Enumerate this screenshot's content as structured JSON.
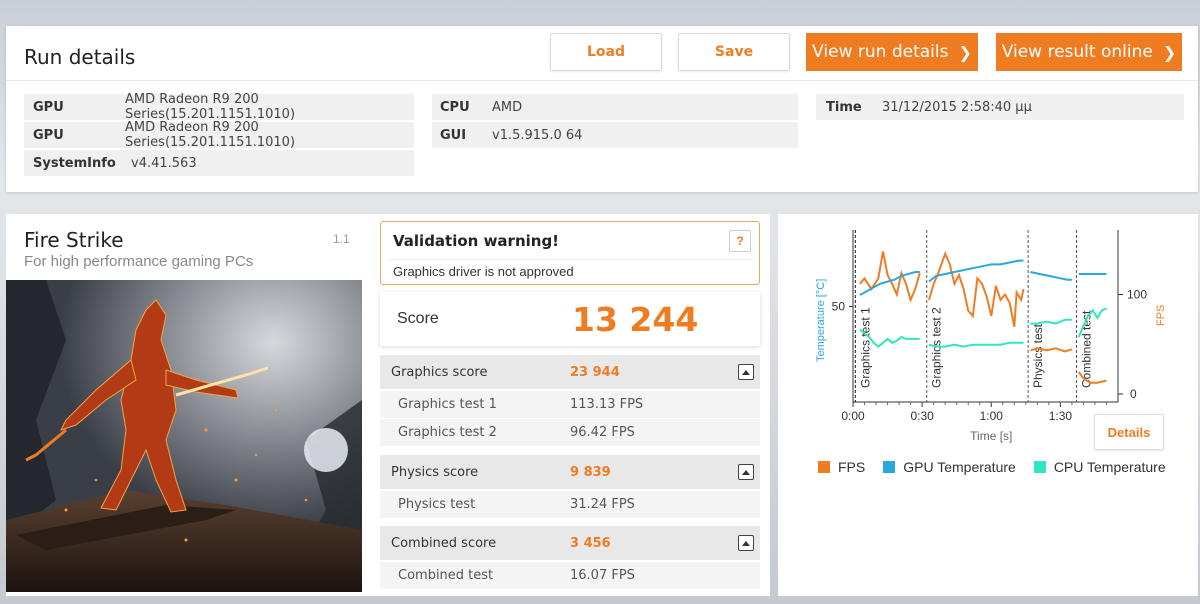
{
  "run_details": {
    "title": "Run details",
    "load_label": "Load",
    "save_label": "Save",
    "view_run_details_label": "View run details",
    "view_result_online_label": "View result online",
    "info": {
      "gpu1_key": "GPU",
      "gpu1_val": "AMD Radeon R9 200 Series(15.201.1151.1010)",
      "gpu2_key": "GPU",
      "gpu2_val": "AMD Radeon R9 200 Series(15.201.1151.1010)",
      "sysinfo_key": "SystemInfo",
      "sysinfo_val": "v4.41.563",
      "cpu_key": "CPU",
      "cpu_val": "AMD",
      "gui_key": "GUI",
      "gui_val": "v1.5.915.0 64",
      "time_key": "Time",
      "time_val": "31/12/2015 2:58:40 μμ"
    }
  },
  "benchmark": {
    "title": "Fire Strike",
    "subtitle": "For high performance gaming PCs",
    "version": "1.1"
  },
  "validation": {
    "title": "Validation warning!",
    "help": "?",
    "message": "Graphics driver is not approved"
  },
  "score": {
    "label": "Score",
    "value": "13 244"
  },
  "graphics": {
    "label": "Graphics score",
    "value": "23 944",
    "test1_label": "Graphics test 1",
    "test1_value": "113.13 FPS",
    "test2_label": "Graphics test 2",
    "test2_value": "96.42 FPS"
  },
  "physics": {
    "label": "Physics score",
    "value": "9 839",
    "test_label": "Physics test",
    "test_value": "31.24 FPS"
  },
  "combined": {
    "label": "Combined score",
    "value": "3 456",
    "test_label": "Combined test",
    "test_value": "16.07 FPS"
  },
  "chart": {
    "details_label": "Details",
    "legend": {
      "fps": "FPS",
      "gpu_temp": "GPU Temperature",
      "cpu_temp": "CPU Temperature"
    },
    "colors": {
      "fps": "#f07c22",
      "gpu": "#2aa7e0",
      "cpu": "#2ee6c0"
    }
  },
  "chart_data": {
    "type": "line",
    "xlabel": "Time [s]",
    "ylabel_left": "Temperature [°C]",
    "ylabel_right": "FPS",
    "x_ticks": [
      "0:00",
      "0:30",
      "1:00",
      "1:30"
    ],
    "y_left_ticks": [
      "50"
    ],
    "y_right_ticks": [
      "100",
      "0"
    ],
    "x_range_s": [
      0,
      115
    ],
    "y_left_range": [
      0,
      90
    ],
    "y_right_range": [
      0,
      160
    ],
    "sections": [
      {
        "name": "Graphics test 1",
        "x": 1
      },
      {
        "name": "Graphics test 2",
        "x": 32
      },
      {
        "name": "Physics test",
        "x": 76
      },
      {
        "name": "Combined test",
        "x": 97
      }
    ],
    "series": [
      {
        "name": "FPS",
        "axis": "right",
        "segments": [
          [
            [
              3,
              110
            ],
            [
              5,
              115
            ],
            [
              8,
              105
            ],
            [
              11,
              115
            ],
            [
              13,
              140
            ],
            [
              15,
              118
            ],
            [
              17,
              110
            ],
            [
              19,
              100
            ],
            [
              21,
              120
            ],
            [
              23,
              110
            ],
            [
              25,
              95
            ],
            [
              27,
              105
            ],
            [
              29,
              120
            ]
          ],
          [
            [
              33,
              95
            ],
            [
              35,
              110
            ],
            [
              37,
              120
            ],
            [
              40,
              138
            ],
            [
              42,
              128
            ],
            [
              44,
              110
            ],
            [
              46,
              118
            ],
            [
              48,
              105
            ],
            [
              50,
              85
            ],
            [
              52,
              80
            ],
            [
              54,
              115
            ],
            [
              56,
              110
            ],
            [
              58,
              98
            ],
            [
              60,
              80
            ],
            [
              62,
              108
            ],
            [
              64,
              95
            ],
            [
              66,
              100
            ],
            [
              68,
              92
            ],
            [
              70,
              70
            ],
            [
              71,
              102
            ],
            [
              73,
              95
            ],
            [
              74,
              105
            ]
          ],
          [
            [
              77,
              48
            ],
            [
              80,
              50
            ],
            [
              84,
              48
            ],
            [
              88,
              50
            ],
            [
              92,
              47
            ],
            [
              95,
              49
            ]
          ],
          [
            [
              98,
              28
            ],
            [
              100,
              22
            ],
            [
              103,
              18
            ],
            [
              106,
              18
            ],
            [
              110,
              20
            ]
          ]
        ]
      },
      {
        "name": "GPU Temperature",
        "axis": "left",
        "segments": [
          [
            [
              3,
              56
            ],
            [
              6,
              58
            ],
            [
              9,
              60
            ],
            [
              12,
              62
            ],
            [
              15,
              63
            ],
            [
              18,
              64
            ],
            [
              21,
              66
            ],
            [
              24,
              67
            ],
            [
              27,
              68
            ],
            [
              29,
              68
            ]
          ],
          [
            [
              33,
              63
            ],
            [
              36,
              66
            ],
            [
              40,
              67
            ],
            [
              44,
              68
            ],
            [
              48,
              69
            ],
            [
              52,
              70
            ],
            [
              56,
              71
            ],
            [
              60,
              72
            ],
            [
              64,
              72
            ],
            [
              68,
              73
            ],
            [
              72,
              74
            ],
            [
              74,
              74
            ]
          ],
          [
            [
              77,
              68
            ],
            [
              81,
              67
            ],
            [
              85,
              66
            ],
            [
              89,
              65
            ],
            [
              93,
              64
            ],
            [
              95,
              64
            ]
          ],
          [
            [
              98,
              67
            ],
            [
              102,
              67
            ],
            [
              106,
              67
            ],
            [
              110,
              67
            ]
          ]
        ]
      },
      {
        "name": "CPU Temperature",
        "axis": "left",
        "segments": [
          [
            [
              3,
              38
            ],
            [
              5,
              36
            ],
            [
              7,
              34
            ],
            [
              9,
              31
            ],
            [
              11,
              29
            ],
            [
              13,
              31
            ],
            [
              15,
              33
            ],
            [
              17,
              31
            ],
            [
              19,
              32
            ],
            [
              21,
              34
            ],
            [
              23,
              33
            ],
            [
              25,
              33
            ],
            [
              27,
              33
            ],
            [
              29,
              33
            ]
          ],
          [
            [
              33,
              30
            ],
            [
              36,
              29
            ],
            [
              40,
              29
            ],
            [
              44,
              30
            ],
            [
              48,
              29
            ],
            [
              52,
              30
            ],
            [
              56,
              30
            ],
            [
              60,
              30
            ],
            [
              64,
              30
            ],
            [
              68,
              31
            ],
            [
              72,
              31
            ],
            [
              74,
              31
            ]
          ],
          [
            [
              77,
              41
            ],
            [
              80,
              41
            ],
            [
              84,
              42
            ],
            [
              88,
              41
            ],
            [
              92,
              43
            ],
            [
              95,
              43
            ]
          ],
          [
            [
              98,
              34
            ],
            [
              100,
              40
            ],
            [
              102,
              45
            ],
            [
              104,
              48
            ],
            [
              106,
              44
            ],
            [
              108,
              48
            ],
            [
              110,
              49
            ]
          ]
        ]
      }
    ]
  }
}
